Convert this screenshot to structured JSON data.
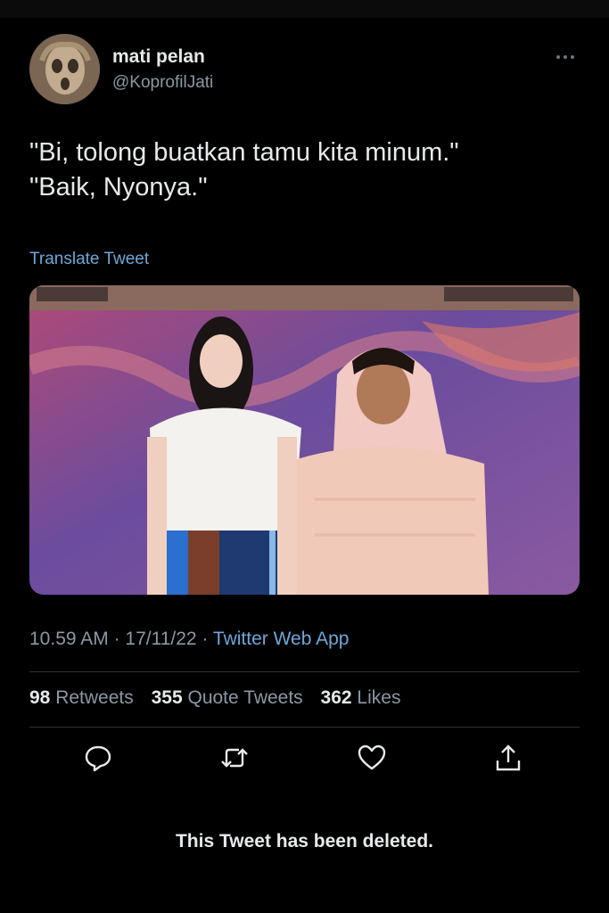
{
  "author": {
    "display_name": "mati pelan",
    "handle": "@KoprofilJati"
  },
  "tweet": {
    "lines": [
      "\"Bi, tolong buatkan tamu kita minum.\"",
      "\"Baik, Nyonya.\""
    ],
    "translate_label": "Translate Tweet"
  },
  "meta": {
    "time": "10.59 AM",
    "separator": "·",
    "date": "17/11/22",
    "source": "Twitter Web App"
  },
  "stats": {
    "retweets_count": "98",
    "retweets_label": "Retweets",
    "quotes_count": "355",
    "quotes_label": "Quote Tweets",
    "likes_count": "362",
    "likes_label": "Likes"
  },
  "actions": [
    "reply-icon",
    "retweet-icon",
    "like-icon",
    "share-icon"
  ],
  "deleted_notice": "This Tweet has been deleted.",
  "colors": {
    "background": "#000000",
    "text": "#e7e9ea",
    "secondary": "#8b98a5",
    "link": "#6ea8d9",
    "divider": "#2f3336"
  }
}
